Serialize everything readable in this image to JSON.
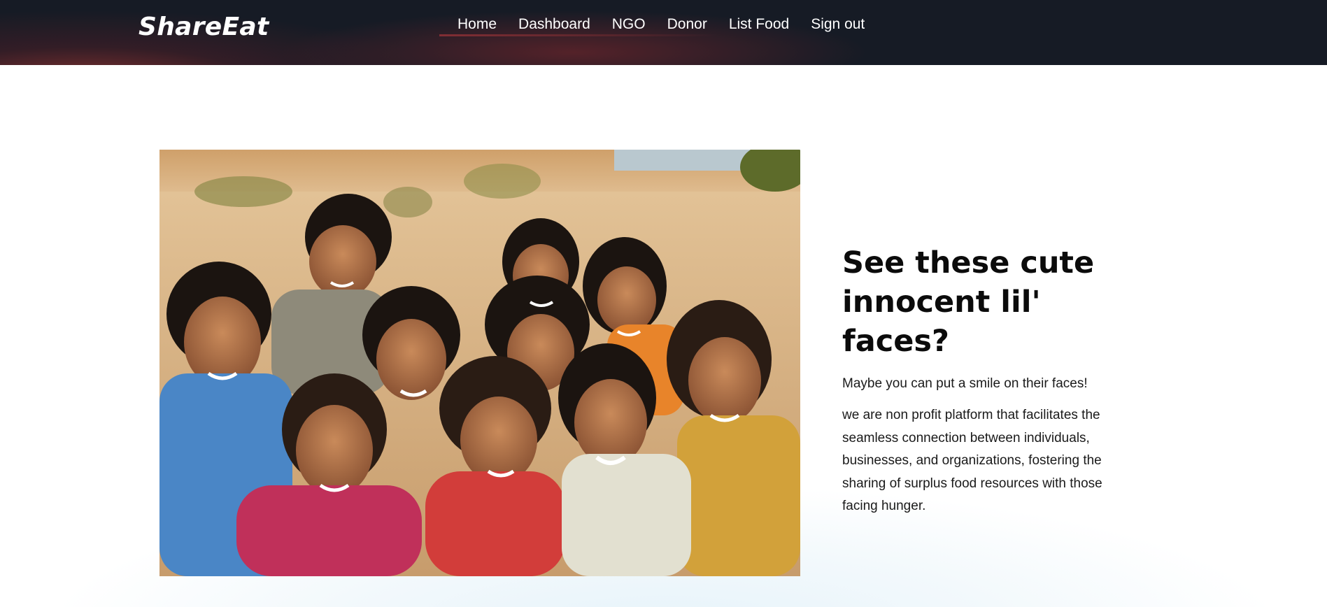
{
  "navbar": {
    "brand": "ShareEat",
    "links": [
      {
        "label": "Home"
      },
      {
        "label": "Dashboard"
      },
      {
        "label": "NGO"
      },
      {
        "label": "Donor"
      },
      {
        "label": "List Food"
      },
      {
        "label": "Sign out"
      }
    ]
  },
  "hero": {
    "image_alt": "Group of smiling children sitting together in a desert",
    "headline": "See these cute innocent lil' faces?",
    "subtitle": "Maybe you can put a smile on their faces!",
    "description": "we are non profit platform that facilitates the seamless connection between individuals, businesses, and organizations, fostering the sharing of surplus food resources with those facing hunger."
  },
  "colors": {
    "navbar_bg": "#161b25",
    "navbar_glow": "#7a2e2e",
    "text_primary": "#0b0b0b"
  }
}
